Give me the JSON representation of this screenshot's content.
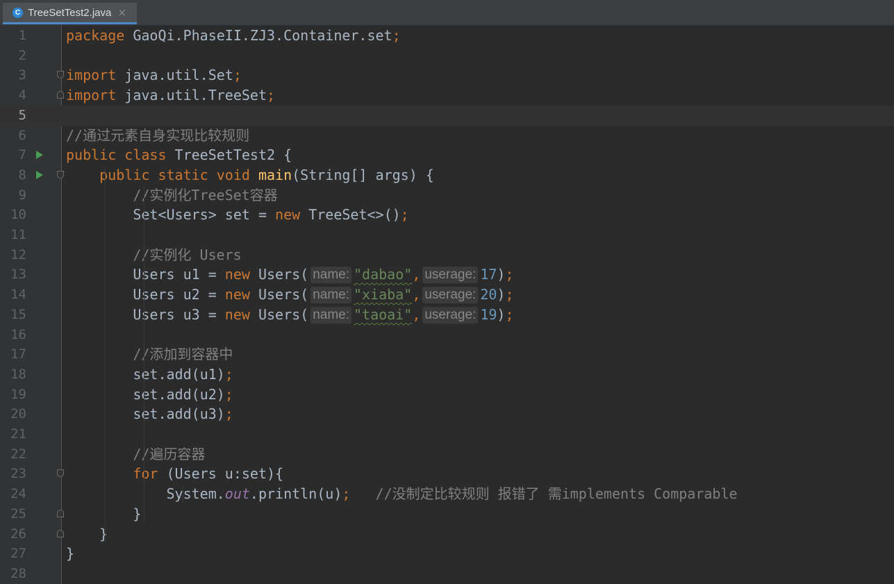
{
  "tab": {
    "filename": "TreeSetTest2.java",
    "icon": "class-icon",
    "icon_letter": "C",
    "close_glyph": "×"
  },
  "editor": {
    "current_line": 5,
    "lines": [
      {
        "n": "1",
        "tokens": [
          [
            "kw",
            "package "
          ],
          [
            "",
            "GaoQi.PhaseII.ZJ3.Container.set"
          ],
          [
            "kw",
            ";"
          ]
        ]
      },
      {
        "n": "2",
        "tokens": []
      },
      {
        "n": "3",
        "fold": "open",
        "tokens": [
          [
            "kw",
            "import "
          ],
          [
            "",
            "java.util.Set"
          ],
          [
            "kw",
            ";"
          ]
        ]
      },
      {
        "n": "4",
        "fold": "close",
        "tokens": [
          [
            "kw",
            "import "
          ],
          [
            "",
            "java.util.TreeSet"
          ],
          [
            "kw",
            ";"
          ]
        ]
      },
      {
        "n": "5",
        "tokens": []
      },
      {
        "n": "6",
        "tokens": [
          [
            "cm",
            "//通过元素自身实现比较规则"
          ]
        ]
      },
      {
        "n": "7",
        "run": true,
        "tokens": [
          [
            "kw",
            "public class "
          ],
          [
            "",
            "TreeSetTest2 {"
          ]
        ]
      },
      {
        "n": "8",
        "run": true,
        "fold": "open",
        "tokens": [
          [
            "",
            "    "
          ],
          [
            "kw",
            "public static void "
          ],
          [
            "fn",
            "main"
          ],
          [
            "",
            "(String[] args) {"
          ]
        ]
      },
      {
        "n": "9",
        "tokens": [
          [
            "",
            "        "
          ],
          [
            "cm",
            "//实例化TreeSet容器"
          ]
        ]
      },
      {
        "n": "10",
        "tokens": [
          [
            "",
            "        Set<Users> set = "
          ],
          [
            "kw",
            "new "
          ],
          [
            "",
            "TreeSet<>()"
          ],
          [
            "kw",
            ";"
          ]
        ]
      },
      {
        "n": "11",
        "tokens": []
      },
      {
        "n": "12",
        "tokens": [
          [
            "",
            "        "
          ],
          [
            "cm",
            "//实例化 Users"
          ]
        ]
      },
      {
        "n": "13",
        "tokens": [
          [
            "",
            "        Users u1 = "
          ],
          [
            "kw",
            "new "
          ],
          [
            "",
            "Users("
          ],
          [
            "hint",
            "name:"
          ],
          [
            "str",
            "\"dabao\""
          ],
          [
            "kw",
            ","
          ],
          [
            "hint",
            "userage:"
          ],
          [
            "num",
            "17"
          ],
          [
            "",
            ")"
          ],
          [
            "kw",
            ";"
          ]
        ]
      },
      {
        "n": "14",
        "tokens": [
          [
            "",
            "        Users u2 = "
          ],
          [
            "kw",
            "new "
          ],
          [
            "",
            "Users("
          ],
          [
            "hint",
            "name:"
          ],
          [
            "str",
            "\"xiaba\""
          ],
          [
            "kw",
            ","
          ],
          [
            "hint",
            "userage:"
          ],
          [
            "num",
            "20"
          ],
          [
            "",
            ")"
          ],
          [
            "kw",
            ";"
          ]
        ]
      },
      {
        "n": "15",
        "tokens": [
          [
            "",
            "        Users u3 = "
          ],
          [
            "kw",
            "new "
          ],
          [
            "",
            "Users("
          ],
          [
            "hint",
            "name:"
          ],
          [
            "str",
            "\"taoai\""
          ],
          [
            "kw",
            ","
          ],
          [
            "hint",
            "userage:"
          ],
          [
            "num",
            "19"
          ],
          [
            "",
            ")"
          ],
          [
            "kw",
            ";"
          ]
        ]
      },
      {
        "n": "16",
        "tokens": []
      },
      {
        "n": "17",
        "tokens": [
          [
            "",
            "        "
          ],
          [
            "cm",
            "//添加到容器中"
          ]
        ]
      },
      {
        "n": "18",
        "tokens": [
          [
            "",
            "        set.add(u1)"
          ],
          [
            "kw",
            ";"
          ]
        ]
      },
      {
        "n": "19",
        "tokens": [
          [
            "",
            "        set.add(u2)"
          ],
          [
            "kw",
            ";"
          ]
        ]
      },
      {
        "n": "20",
        "tokens": [
          [
            "",
            "        set.add(u3)"
          ],
          [
            "kw",
            ";"
          ]
        ]
      },
      {
        "n": "21",
        "tokens": []
      },
      {
        "n": "22",
        "tokens": [
          [
            "",
            "        "
          ],
          [
            "cm",
            "//遍历容器"
          ]
        ]
      },
      {
        "n": "23",
        "fold": "open",
        "tokens": [
          [
            "",
            "        "
          ],
          [
            "kw",
            "for "
          ],
          [
            "",
            "(Users u:set){"
          ]
        ]
      },
      {
        "n": "24",
        "tokens": [
          [
            "",
            "            System."
          ],
          [
            "field",
            "out"
          ],
          [
            "",
            ".println(u)"
          ],
          [
            "kw",
            ";"
          ],
          [
            "",
            "   "
          ],
          [
            "cm",
            "//没制定比较规则 报错了 需implements Comparable"
          ]
        ]
      },
      {
        "n": "25",
        "fold": "close",
        "tokens": [
          [
            "",
            "        }"
          ]
        ]
      },
      {
        "n": "26",
        "fold": "close",
        "tokens": [
          [
            "",
            "    }"
          ]
        ]
      },
      {
        "n": "27",
        "tokens": [
          [
            "",
            "}"
          ]
        ]
      },
      {
        "n": "28",
        "tokens": []
      }
    ]
  },
  "colors": {
    "background": "#2b2b2b",
    "gutter": "#313335",
    "keyword": "#cc7832",
    "comment": "#808080",
    "string": "#6a8759",
    "number": "#6897bb",
    "method": "#ffc66d",
    "field": "#9876aa",
    "text": "#a9b7c6"
  }
}
